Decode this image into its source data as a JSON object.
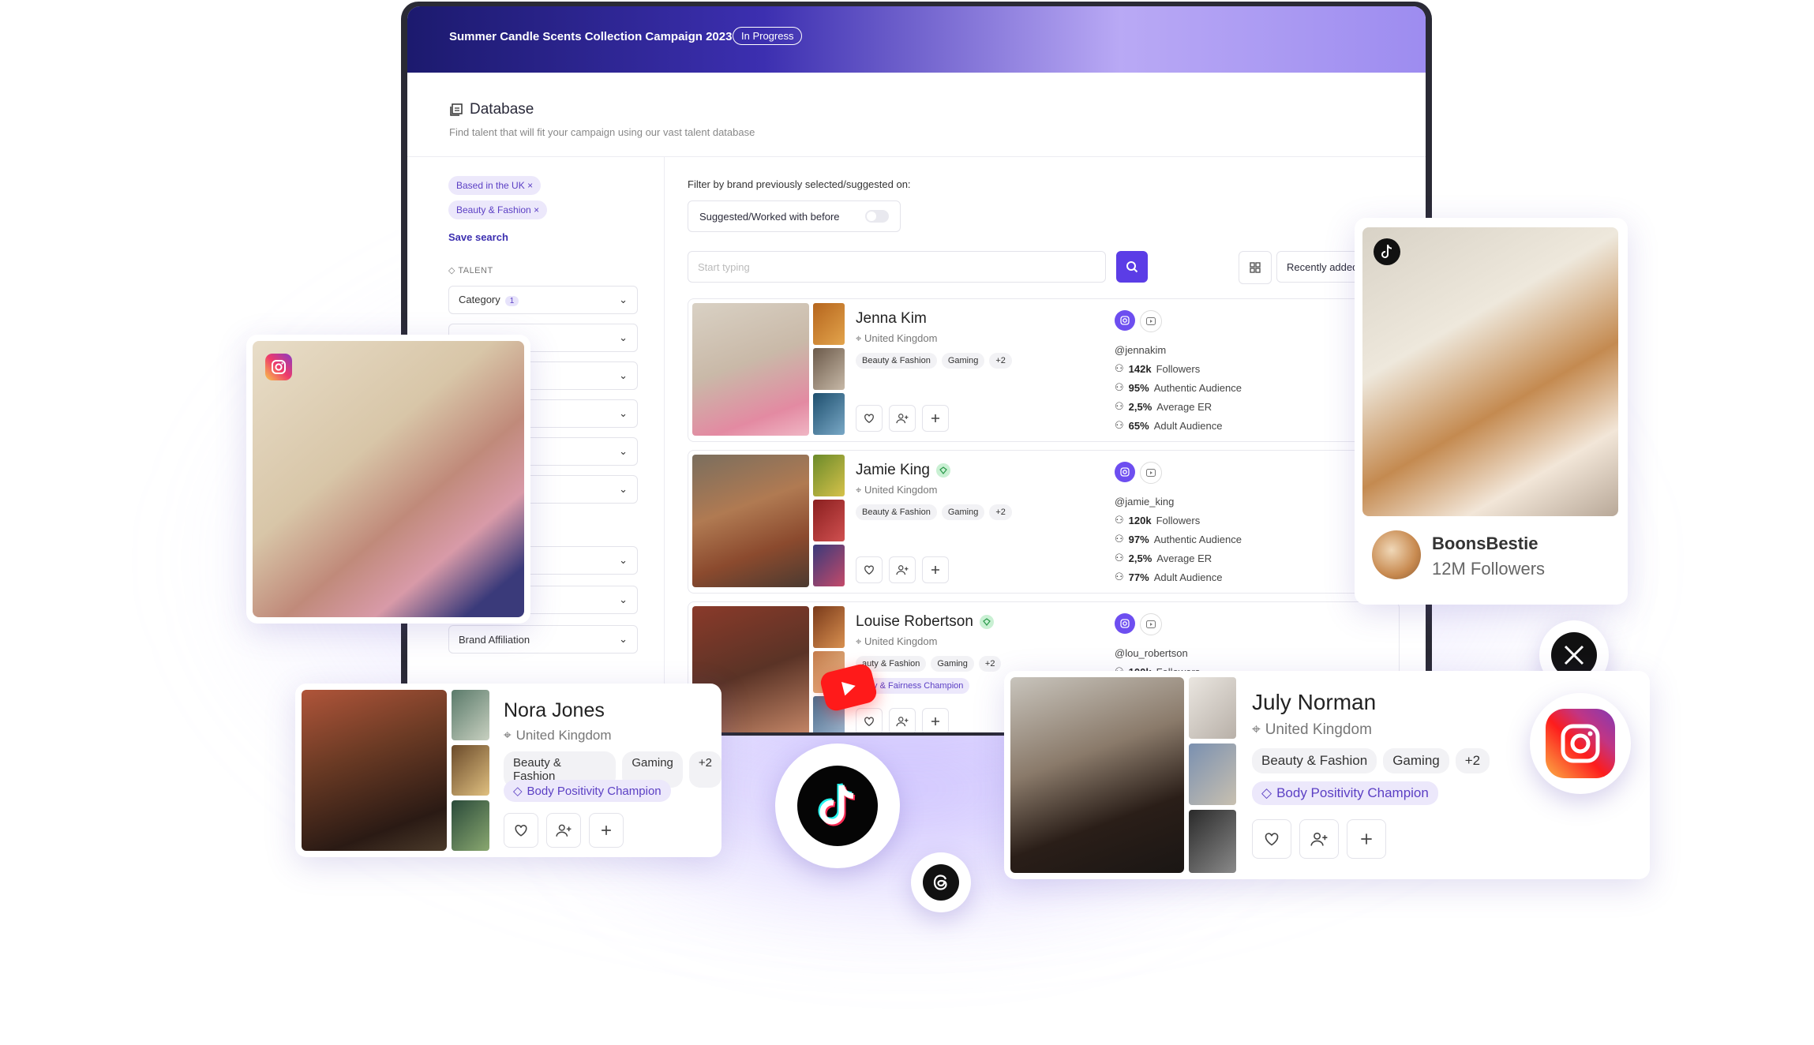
{
  "campaign": {
    "title": "Summer Candle Scents Collection Campaign 2023",
    "status": "In Progress"
  },
  "database": {
    "title": "Database",
    "subtitle": "Find talent that will fit your campaign using our vast talent database"
  },
  "filters": {
    "chips": [
      "Based in the UK",
      "Beauty & Fashion"
    ],
    "chip_remove": "×",
    "save_search": "Save search",
    "section_label": "TALENT",
    "category_label": "Category",
    "category_count": "1",
    "brand_affiliation": "Brand Affiliation",
    "partial_label": "e"
  },
  "brand_filter": {
    "label": "Filter by brand previously selected/suggested on:",
    "toggle_label": "Suggested/Worked with before"
  },
  "search": {
    "placeholder": "Start typing",
    "sort_label": "Recently added"
  },
  "talents": [
    {
      "name": "Jenna Kim",
      "location": "United Kingdom",
      "tags": [
        "Beauty & Fashion",
        "Gaming",
        "+2"
      ],
      "handle": "@jennakim",
      "followers": "142k",
      "followers_label": "Followers",
      "authentic": "95%",
      "authentic_label": "Authentic Audience",
      "er": "2,5%",
      "er_label": "Average ER",
      "adult": "65%",
      "adult_label": "Adult Audience"
    },
    {
      "name": "Jamie King",
      "location": "United Kingdom",
      "tags": [
        "Beauty & Fashion",
        "Gaming",
        "+2"
      ],
      "handle": "@jamie_king",
      "followers": "120k",
      "followers_label": "Followers",
      "authentic": "97%",
      "authentic_label": "Authentic Audience",
      "er": "2,5%",
      "er_label": "Average ER",
      "adult": "77%",
      "adult_label": "Adult Audience"
    },
    {
      "name": "Louise Robertson",
      "location": "United Kingdom",
      "tags": [
        "auty & Fashion",
        "Gaming",
        "+2"
      ],
      "champion": "ality & Fairness Champion",
      "handle": "@lou_robertson",
      "followers": "100k",
      "followers_label": "Followers"
    }
  ],
  "nora": {
    "name": "Nora Jones",
    "location": "United Kingdom",
    "tags": [
      "Beauty & Fashion",
      "Gaming",
      "+2"
    ],
    "champion": "Body Positivity Champion"
  },
  "july": {
    "name": "July Norman",
    "location": "United Kingdom",
    "tags": [
      "Beauty & Fashion",
      "Gaming",
      "+2"
    ],
    "champion": "Body Positivity Champion"
  },
  "boons": {
    "name": "BoonsBestie",
    "followers": "12M Followers"
  },
  "colors": {
    "accent": "#5b3de6",
    "chip_bg": "#ece8fb",
    "chip_text": "#5b3fc4"
  }
}
